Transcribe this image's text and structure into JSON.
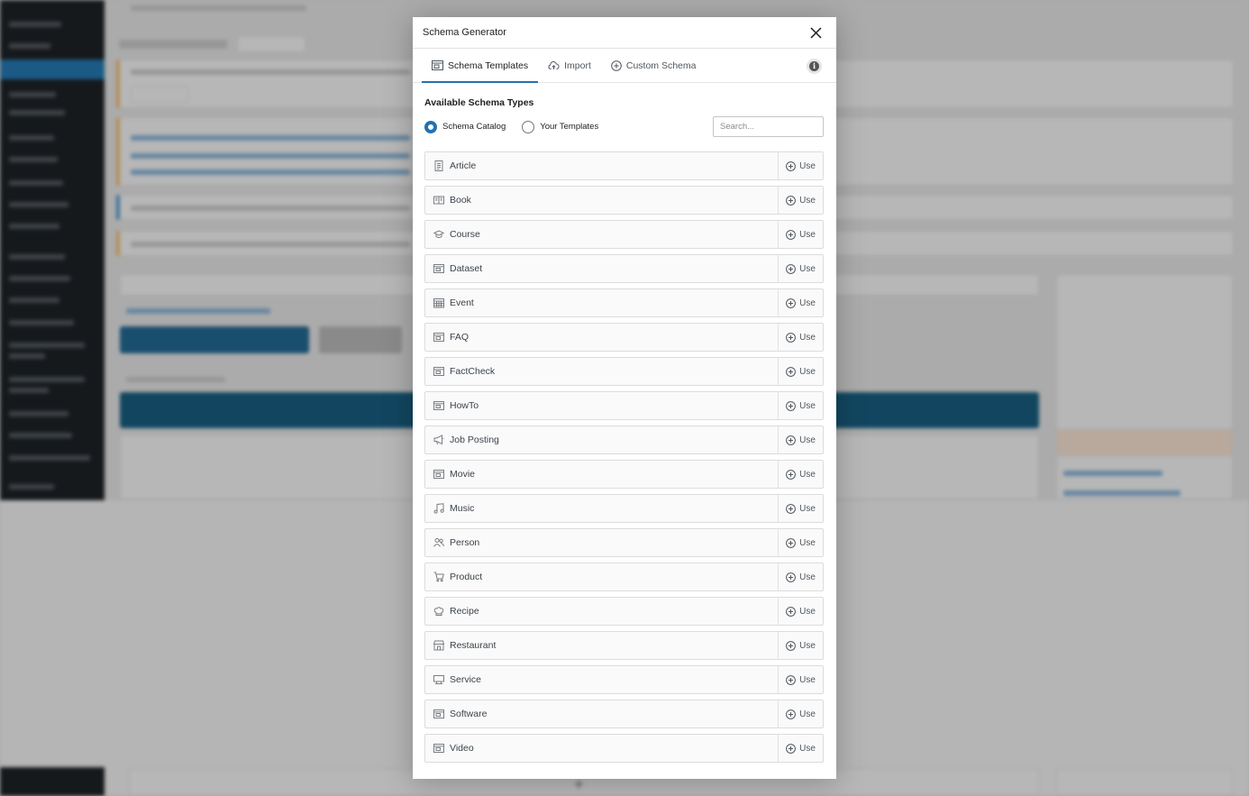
{
  "modal": {
    "title": "Schema Generator",
    "tabs": [
      {
        "label": "Schema Templates",
        "icon": "template-icon",
        "active": true
      },
      {
        "label": "Import",
        "icon": "cloud-upload-icon",
        "active": false
      },
      {
        "label": "Custom Schema",
        "icon": "plus-circle-icon",
        "active": false
      }
    ],
    "section_title": "Available Schema Types",
    "radios": [
      {
        "label": "Schema Catalog",
        "checked": true
      },
      {
        "label": "Your Templates",
        "checked": false
      }
    ],
    "search": {
      "placeholder": "Search...",
      "value": ""
    },
    "use_label": "Use",
    "schema_types": [
      {
        "label": "Article",
        "icon": "document-icon"
      },
      {
        "label": "Book",
        "icon": "book-icon"
      },
      {
        "label": "Course",
        "icon": "graduation-cap-icon"
      },
      {
        "label": "Dataset",
        "icon": "template-icon"
      },
      {
        "label": "Event",
        "icon": "calendar-icon"
      },
      {
        "label": "FAQ",
        "icon": "template-icon"
      },
      {
        "label": "FactCheck",
        "icon": "template-icon"
      },
      {
        "label": "HowTo",
        "icon": "template-icon"
      },
      {
        "label": "Job Posting",
        "icon": "megaphone-icon"
      },
      {
        "label": "Movie",
        "icon": "template-icon"
      },
      {
        "label": "Music",
        "icon": "music-note-icon"
      },
      {
        "label": "Person",
        "icon": "people-icon"
      },
      {
        "label": "Product",
        "icon": "cart-icon"
      },
      {
        "label": "Recipe",
        "icon": "chef-hat-icon"
      },
      {
        "label": "Restaurant",
        "icon": "store-icon"
      },
      {
        "label": "Service",
        "icon": "service-icon"
      },
      {
        "label": "Software",
        "icon": "template-icon"
      },
      {
        "label": "Video",
        "icon": "template-icon"
      }
    ]
  },
  "colors": {
    "accent": "#2271b1",
    "admin_menu": "#16191c"
  }
}
